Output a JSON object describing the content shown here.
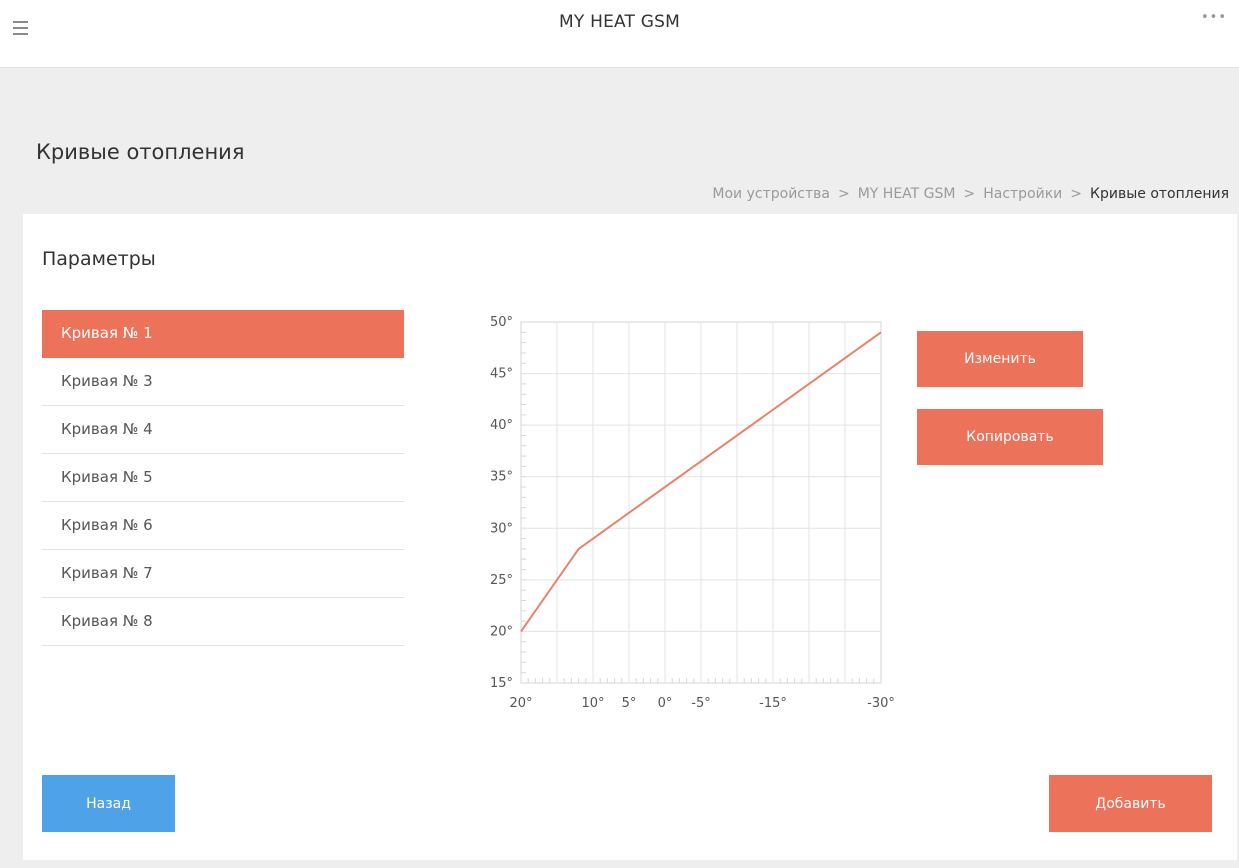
{
  "header": {
    "title": "MY HEAT GSM",
    "menu_icon": "hamburger-icon",
    "more_label": "•••"
  },
  "page": {
    "title": "Кривые отопления"
  },
  "breadcrumb": {
    "items": [
      "Мои устройства",
      "MY HEAT GSM",
      "Настройки"
    ],
    "current": "Кривые отопления",
    "separator": ">"
  },
  "panel": {
    "title": "Параметры"
  },
  "curves": {
    "items": [
      "Кривая № 1",
      "Кривая № 3",
      "Кривая № 4",
      "Кривая № 5",
      "Кривая № 6",
      "Кривая № 7",
      "Кривая № 8"
    ],
    "selected_index": 0
  },
  "buttons": {
    "edit": "Изменить",
    "copy": "Копировать",
    "back": "Назад",
    "add": "Добавить"
  },
  "colors": {
    "accent": "#ec7259",
    "back_button": "#4ea3e8",
    "curve_line": "#e8826b"
  },
  "chart_data": {
    "type": "line",
    "xlim": [
      20,
      -30
    ],
    "ylim": [
      15,
      50
    ],
    "x_ticks": [
      20,
      10,
      5,
      0,
      -5,
      -15,
      -30
    ],
    "x_tick_labels": [
      "20°",
      "10°",
      "5°",
      "0°",
      "-5°",
      "-15°",
      "-30°"
    ],
    "y_ticks": [
      15,
      20,
      25,
      30,
      35,
      40,
      45,
      50
    ],
    "y_tick_labels": [
      "15°",
      "20°",
      "25°",
      "30°",
      "35°",
      "40°",
      "45°",
      "50°"
    ],
    "grid": true,
    "series": [
      {
        "x": [
          20,
          12,
          -30
        ],
        "y": [
          20,
          28,
          49
        ]
      }
    ]
  }
}
